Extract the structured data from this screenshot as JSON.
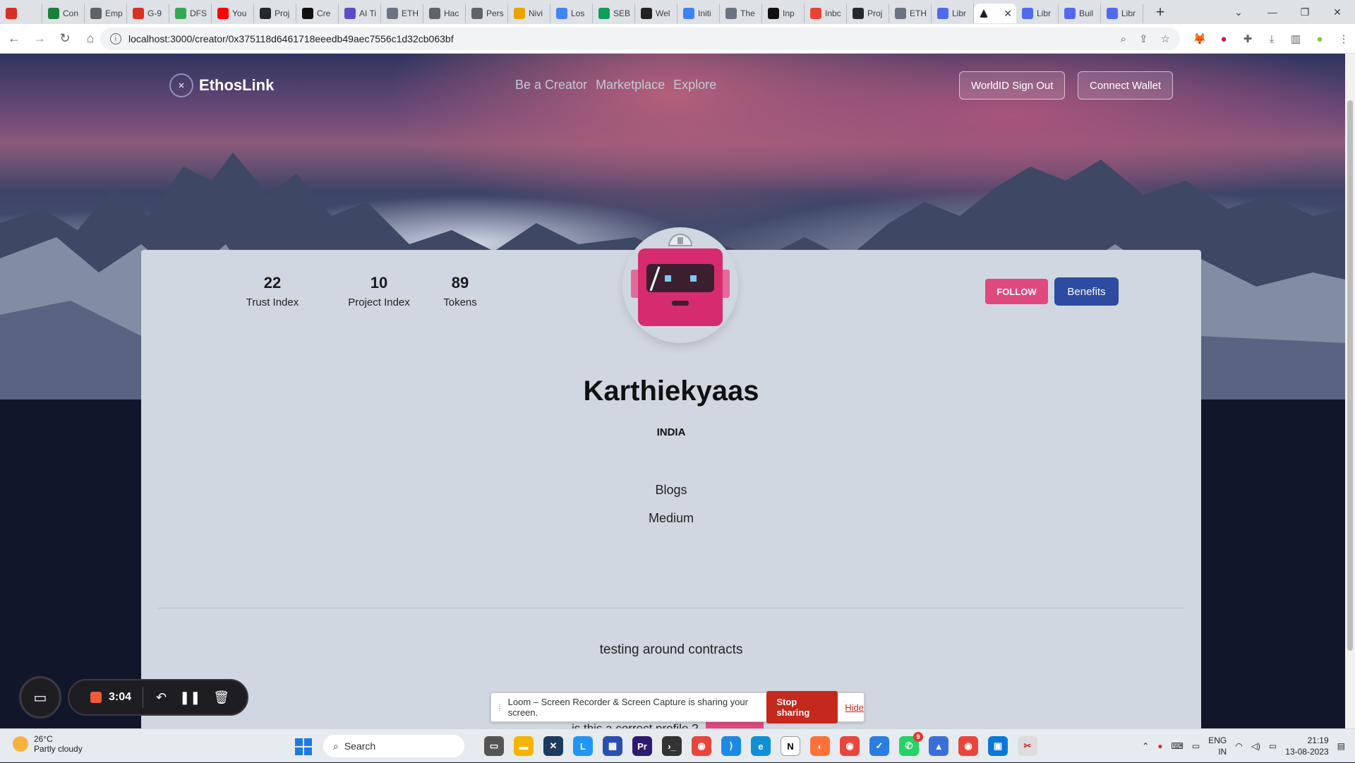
{
  "browser": {
    "tabs": [
      {
        "label": "",
        "color": "#d93025"
      },
      {
        "label": "Con",
        "color": "#188038"
      },
      {
        "label": "Emp",
        "color": "#5f6368"
      },
      {
        "label": "G-9",
        "color": "#d93025"
      },
      {
        "label": "DFS",
        "color": "#34a853"
      },
      {
        "label": "You",
        "color": "#ff0000"
      },
      {
        "label": "Proj",
        "color": "#24292e"
      },
      {
        "label": "Cre",
        "color": "#111111"
      },
      {
        "label": "AI Ti",
        "color": "#5b4bc4"
      },
      {
        "label": "ETH",
        "color": "#6b7280"
      },
      {
        "label": "Hac",
        "color": "#5f6368"
      },
      {
        "label": "Pers",
        "color": "#5f6368"
      },
      {
        "label": "Nivi",
        "color": "#e8a400"
      },
      {
        "label": "Los",
        "color": "#4285f4"
      },
      {
        "label": "SEB",
        "color": "#0f9d58"
      },
      {
        "label": "Wel",
        "color": "#222222"
      },
      {
        "label": "Initi",
        "color": "#3b82f6"
      },
      {
        "label": "The",
        "color": "#6b7280"
      },
      {
        "label": "Inp",
        "color": "#111111"
      },
      {
        "label": "Inbc",
        "color": "#ea4335"
      },
      {
        "label": "Proj",
        "color": "#24292e"
      },
      {
        "label": "ETH",
        "color": "#6b7280"
      },
      {
        "label": "Libr",
        "color": "#4f6bed"
      }
    ],
    "active_tab": {
      "label": "",
      "close": "✕"
    },
    "tabs_after": [
      {
        "label": "Libr",
        "color": "#4f6bed"
      },
      {
        "label": "Buil",
        "color": "#4f6bed"
      },
      {
        "label": "Libr",
        "color": "#4f6bed"
      }
    ],
    "url": "localhost:3000/creator/0x375118d6461718eeedb49aec7556c1d32cb063bf"
  },
  "site": {
    "brand": "EthosLink",
    "menu": [
      "Be a Creator",
      "Marketplace",
      "Explore"
    ],
    "worldid_button": "WorldID Sign Out",
    "wallet_button": "Connect Wallet"
  },
  "profile": {
    "stats": [
      {
        "value": "22",
        "label": "Trust Index"
      },
      {
        "value": "10",
        "label": "Project Index"
      },
      {
        "value": "89",
        "label": "Tokens"
      }
    ],
    "follow_label": "FOLLOW",
    "benefits_label": "Benefits",
    "name": "Karthiekyaas",
    "country": "INDIA",
    "links": [
      "Blogs",
      "Medium"
    ],
    "description": "testing around contracts",
    "verify_prompt": "is this a correct profile ?"
  },
  "loom": {
    "timer": "3:04",
    "share_message": "Loom – Screen Recorder & Screen Capture is sharing your screen.",
    "stop_label": "Stop sharing",
    "hide_label": "Hide"
  },
  "taskbar": {
    "weather_temp": "26°C",
    "weather_desc": "Partly cloudy",
    "search_placeholder": "Search",
    "lang_top": "ENG",
    "lang_bottom": "IN",
    "time": "21:19",
    "date": "13-08-2023",
    "whatsapp_badge": "9"
  }
}
